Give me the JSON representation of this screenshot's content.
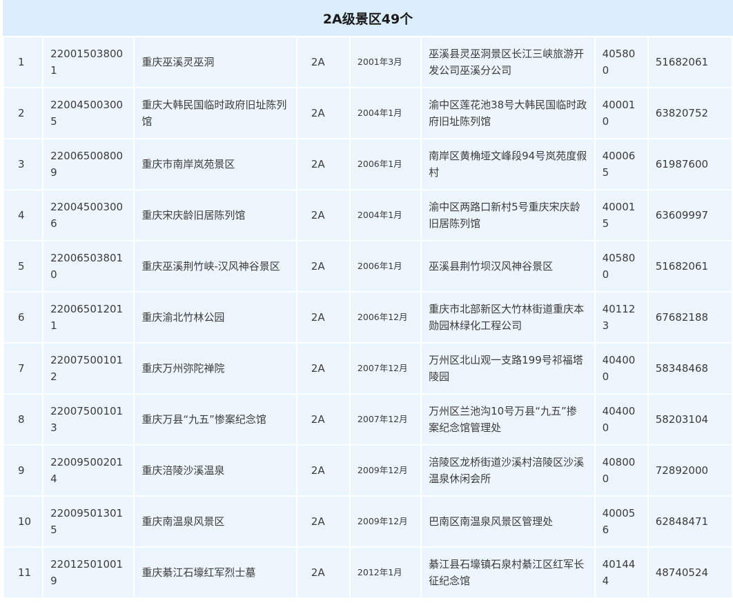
{
  "header": {
    "title": "2A级景区49个"
  },
  "rows": [
    {
      "idx": "1",
      "code": "220015038001",
      "name": "重庆巫溪灵巫洞",
      "grade": "2A",
      "date": "2001年3月",
      "address": "巫溪县灵巫洞景区长江三峡旅游开发公司巫溪分公司",
      "postcode": "405800",
      "phone": "51682061"
    },
    {
      "idx": "2",
      "code": "220045003005",
      "name": "重庆大韩民国临时政府旧址陈列馆",
      "grade": "2A",
      "date": "2004年1月",
      "address": "渝中区莲花池38号大韩民国临时政府旧址陈列馆",
      "postcode": "400010",
      "phone": "63820752"
    },
    {
      "idx": "3",
      "code": "220065008009",
      "name": "重庆市南岸岚苑景区",
      "grade": "2A",
      "date": "2006年1月",
      "address": "南岸区黄桷垭文峰段94号岚苑度假村",
      "postcode": "400065",
      "phone": "61987600"
    },
    {
      "idx": "4",
      "code": "220045003006",
      "name": "重庆宋庆龄旧居陈列馆",
      "grade": "2A",
      "date": "2004年1月",
      "address": "渝中区两路口新村5号重庆宋庆龄旧居陈列馆",
      "postcode": "400015",
      "phone": "63609997"
    },
    {
      "idx": "5",
      "code": "220065038010",
      "name": "重庆巫溪荆竹峡-汉风神谷景区",
      "grade": "2A",
      "date": "2006年1月",
      "address": "巫溪县荆竹坝汉风神谷景区",
      "postcode": "405800",
      "phone": "51682061"
    },
    {
      "idx": "6",
      "code": "220065012011",
      "name": "重庆渝北竹林公园",
      "grade": "2A",
      "date": "2006年12月",
      "address": "重庆市北部新区大竹林街道重庆本勋园林绿化工程公司",
      "postcode": "401123",
      "phone": "67682188"
    },
    {
      "idx": "7",
      "code": "220075001012",
      "name": "重庆万州弥陀禅院",
      "grade": "2A",
      "date": "2007年12月",
      "address": "万州区北山观一支路199号祁福塔陵园",
      "postcode": "404000",
      "phone": "58348468"
    },
    {
      "idx": "8",
      "code": "220075001013",
      "name": "重庆万县“九五”惨案纪念馆",
      "grade": "2A",
      "date": "2007年12月",
      "address": "万州区兰池沟10号万县“九五”掺案纪念馆管理处",
      "postcode": "404000",
      "phone": "58203104"
    },
    {
      "idx": "9",
      "code": "220095002014",
      "name": "重庆涪陵沙溪温泉",
      "grade": "2A",
      "date": "2009年12月",
      "address": "涪陵区龙桥街道沙溪村涪陵区沙溪温泉休闲会所",
      "postcode": "408000",
      "phone": "72892000"
    },
    {
      "idx": "10",
      "code": "220095013015",
      "name": "重庆南温泉风景区",
      "grade": "2A",
      "date": "2009年12月",
      "address": "巴南区南温泉风景区管理处",
      "postcode": "400056",
      "phone": "62848471"
    },
    {
      "idx": "11",
      "code": "220125010019",
      "name": "重庆綦江石壕红军烈士墓",
      "grade": "2A",
      "date": "2012年1月",
      "address": "綦江县石壕镇石泉村綦江区红军长征纪念馆",
      "postcode": "401444",
      "phone": "48740524"
    }
  ]
}
